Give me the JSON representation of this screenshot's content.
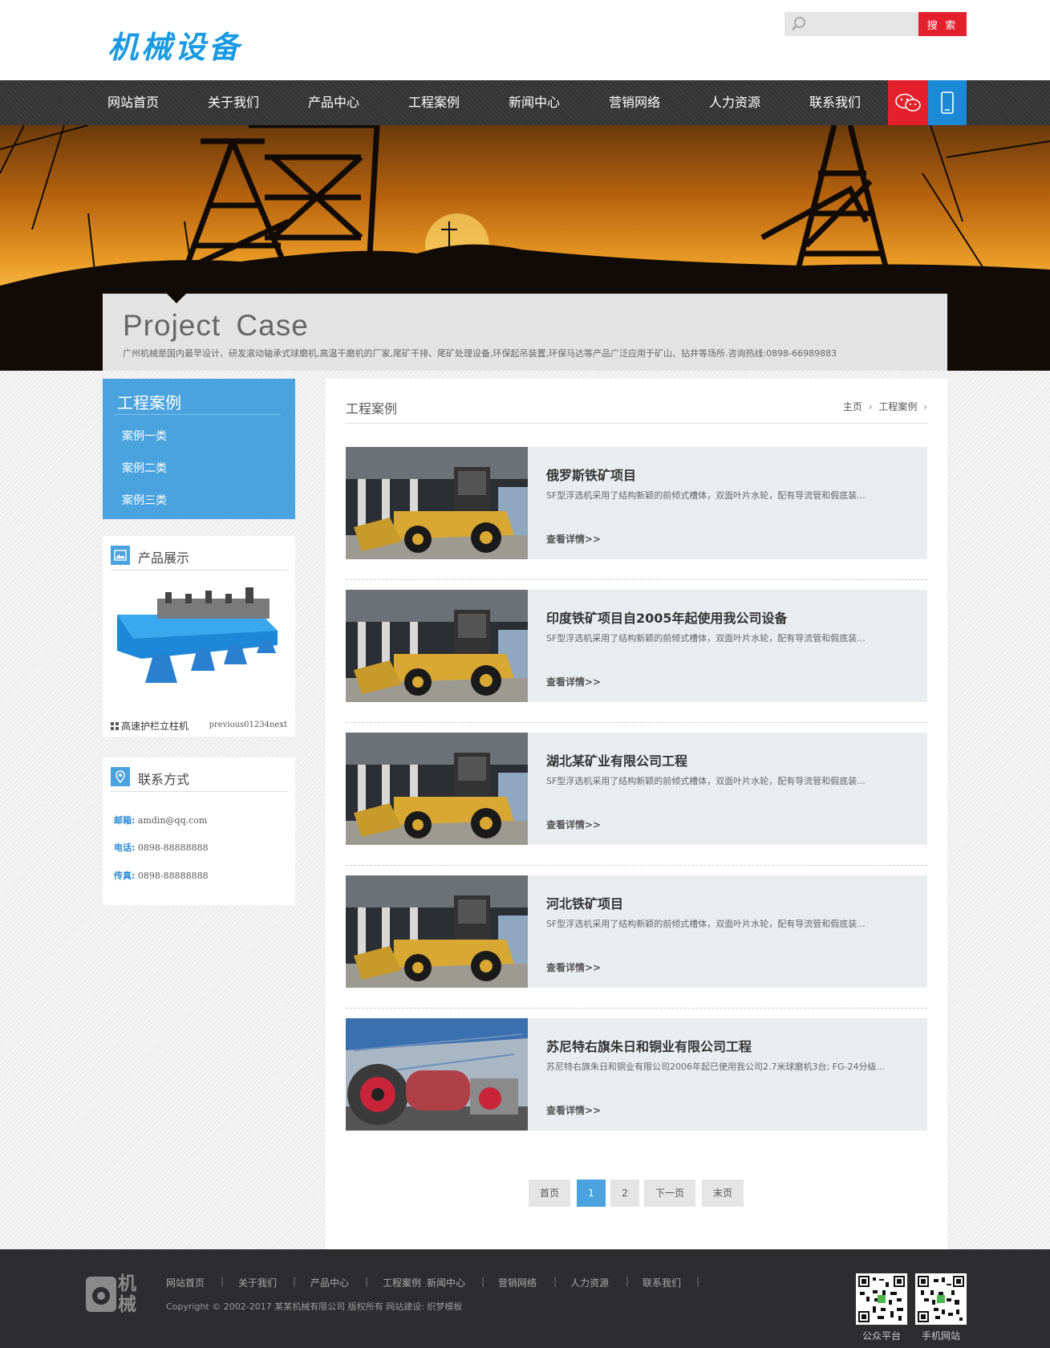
{
  "header": {
    "logo_text": "机械设备",
    "search_placeholder": "",
    "search_button": "搜 索"
  },
  "nav": {
    "items": [
      "网站首页",
      "关于我们",
      "产品中心",
      "工程案例",
      "新闻中心",
      "营销网络",
      "人力资源",
      "联系我们"
    ],
    "wechat_icon": "wechat-icon",
    "mobile_icon": "mobile-icon"
  },
  "banner": {
    "title": "Project Case",
    "description": "广州机械是国内最早设计、研发滚动轴承式球磨机,高温干磨机的厂家,尾矿干排、尾矿处理设备,环保起吊装置,环保马达等产品广泛应用于矿山、钻井等场所.咨询热线:0898-66989883"
  },
  "sidebar": {
    "category_title": "工程案例",
    "categories": [
      "案例一类",
      "案例二类",
      "案例三类"
    ],
    "product_box": {
      "title": "产品展示",
      "caption": "高速护栏立柱机",
      "pager": "previous01234next"
    },
    "contact_box": {
      "title": "联系方式",
      "rows": [
        {
          "label": "邮箱:",
          "value": "amdin@qq.com"
        },
        {
          "label": "电话:",
          "value": "0898-88888888"
        },
        {
          "label": "传真:",
          "value": "0898-88888888"
        }
      ]
    }
  },
  "main": {
    "title": "工程案例",
    "breadcrumb": [
      "主页",
      "工程案例"
    ],
    "cases": [
      {
        "title": "俄罗斯铁矿项目",
        "desc": "SF型浮选机采用了结构新颖的前倾式槽体，双面叶片水轮，配有导流管和假底装...",
        "more": "查看详情>>",
        "image": "loader"
      },
      {
        "title": "印度铁矿项目自2005年起使用我公司设备",
        "desc": "SF型浮选机采用了结构新颖的前倾式槽体，双面叶片水轮，配有导流管和假底装...",
        "more": "查看详情>>",
        "image": "loader"
      },
      {
        "title": "湖北某矿业有限公司工程",
        "desc": "SF型浮选机采用了结构新颖的前倾式槽体，双面叶片水轮，配有导流管和假底装...",
        "more": "查看详情>>",
        "image": "loader"
      },
      {
        "title": "河北铁矿项目",
        "desc": "SF型浮选机采用了结构新颖的前倾式槽体，双面叶片水轮，配有导流管和假底装...",
        "more": "查看详情>>",
        "image": "loader"
      },
      {
        "title": "苏尼特右旗朱日和铜业有限公司工程",
        "desc": "苏尼特右旗朱日和铜业有限公司2006年起已使用我公司2.7米球磨机3台; FG-24分级...",
        "more": "查看详情>>",
        "image": "mill"
      }
    ],
    "pagination": [
      "首页",
      "1",
      "2",
      "下一页",
      "末页"
    ],
    "active_page": "1"
  },
  "footer": {
    "logo_text": "机械",
    "links": [
      "网站首页",
      "关于我们",
      "产品中心",
      "工程案例",
      "新闻中心",
      "营销网络",
      "人力资源",
      "联系我们"
    ],
    "separator": "|",
    "copyright": "Copyright © 2002-2017 某某机械有限公司 版权所有 网站建设: 织梦模板",
    "qr_labels": [
      "公众平台",
      "手机网站"
    ]
  },
  "colors": {
    "accent_blue": "#4aa3de",
    "logo_blue": "#1a9ae0",
    "accent_red": "#e4202c",
    "nav_dark": "#3a3a3a",
    "footer_dark": "#2d2d2f"
  }
}
